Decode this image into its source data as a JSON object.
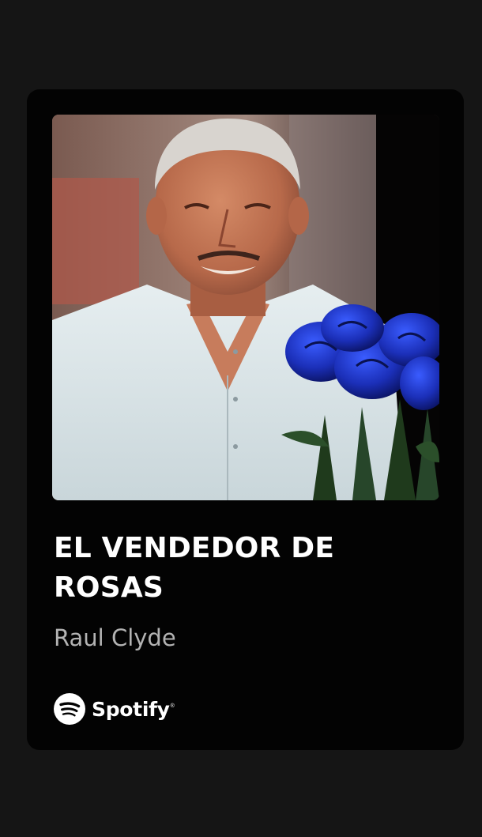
{
  "share_card": {
    "cover": {
      "icon": "album-cover-photo"
    },
    "track_title": "EL VENDEDOR DE ROSAS",
    "artist_name": "Raul Clyde",
    "brand": {
      "name": "Spotify",
      "registered_mark": "®",
      "icon": "spotify-logo-icon",
      "color": "#ffffff"
    }
  },
  "colors": {
    "screen_background": "#151515",
    "card_background": "#030303",
    "title_color": "#ffffff",
    "artist_color": "#b3b3b3"
  }
}
